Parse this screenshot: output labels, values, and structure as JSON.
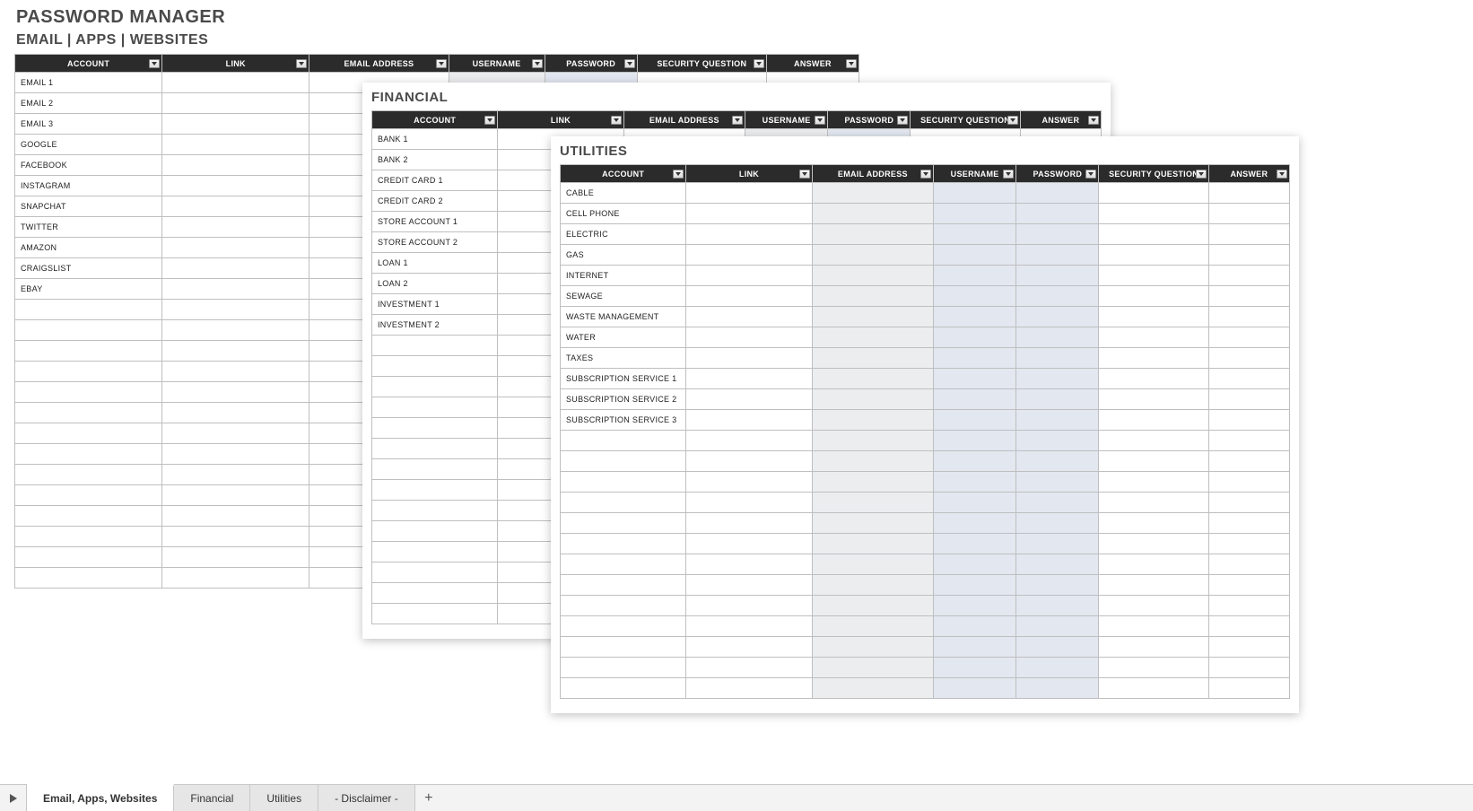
{
  "title": "PASSWORD MANAGER",
  "subtitle": "EMAIL | APPS | WEBSITES",
  "columns": {
    "account": "ACCOUNT",
    "link": "LINK",
    "email": "EMAIL ADDRESS",
    "username": "USERNAME",
    "password": "PASSWORD",
    "secq": "SECURITY QUESTION",
    "answer": "ANSWER"
  },
  "panels": {
    "emails": {
      "rows": [
        "EMAIL 1",
        "EMAIL 2",
        "EMAIL 3",
        "GOOGLE",
        "FACEBOOK",
        "INSTAGRAM",
        "SNAPCHAT",
        "TWITTER",
        "AMAZON",
        "CRAIGSLIST",
        "EBAY"
      ],
      "blank_rows": 14,
      "highlight_cols": [
        4,
        5
      ]
    },
    "financial": {
      "title": "FINANCIAL",
      "rows": [
        "BANK 1",
        "BANK 2",
        "CREDIT CARD 1",
        "CREDIT CARD 2",
        "STORE ACCOUNT 1",
        "STORE ACCOUNT 2",
        "LOAN 1",
        "LOAN 2",
        "INVESTMENT 1",
        "INVESTMENT 2"
      ],
      "blank_rows": 14,
      "highlight_cols": [
        4,
        5
      ]
    },
    "utilities": {
      "title": "UTILITIES",
      "rows": [
        "CABLE",
        "CELL PHONE",
        "ELECTRIC",
        "GAS",
        "INTERNET",
        "SEWAGE",
        "WASTE MANAGEMENT",
        "WATER",
        "TAXES",
        "SUBSCRIPTION SERVICE 1",
        "SUBSCRIPTION SERVICE 2",
        "SUBSCRIPTION SERVICE 3"
      ],
      "blank_rows": 13,
      "highlight_cols": [
        3,
        4,
        5
      ]
    }
  },
  "tabs": {
    "items": [
      "Email, Apps, Websites",
      "Financial",
      "Utilities",
      "- Disclaimer -"
    ],
    "active": 0,
    "add": "+"
  }
}
